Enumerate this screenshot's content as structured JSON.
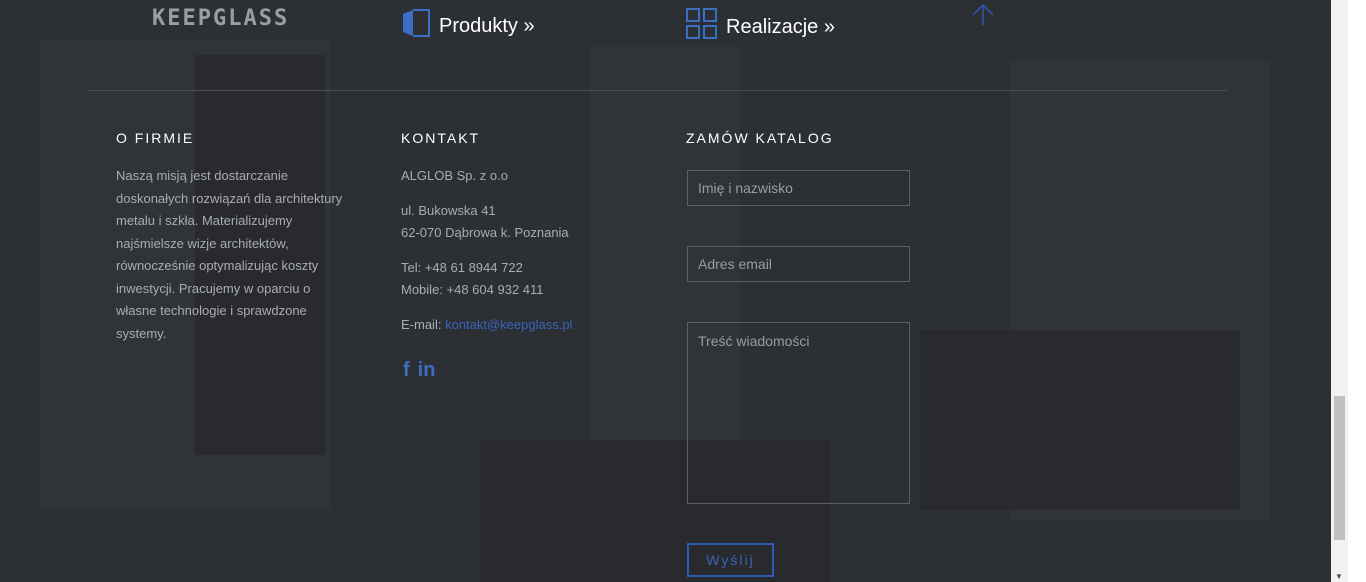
{
  "header": {
    "logo": "KEEPGLASS",
    "produkty_label": "Produkty »",
    "realizacje_label": "Realizacje »"
  },
  "about": {
    "title": "O FIRMIE",
    "text": "Naszą misją jest dostarczanie doskonałych rozwiązań dla architektury metalu i szkła. Materializujemy najśmielsze wizje architektów, równocześnie optymalizując koszty inwestycji. Pracujemy w oparciu o własne technologie i sprawdzone systemy."
  },
  "contact": {
    "title": "KONTAKT",
    "company": "ALGLOB Sp. z o.o",
    "address_line1": "ul. Bukowska 41",
    "address_line2": "62-070 Dąbrowa k. Poznania",
    "tel": "Tel: +48 61 8944 722",
    "mobile": "Mobile: +48 604 932 411",
    "email_label": "E-mail: ",
    "email": "kontakt@keepglass.pl",
    "social": [
      "facebook-icon",
      "linkedin-icon"
    ]
  },
  "catalog": {
    "title": "ZAMÓW KATALOG",
    "name_placeholder": "Imię i nazwisko",
    "email_placeholder": "Adres email",
    "message_placeholder": "Treść wiadomości",
    "send_label": "Wyślij"
  },
  "colors": {
    "background": "#2c2f34",
    "accent": "#3a63b8"
  }
}
